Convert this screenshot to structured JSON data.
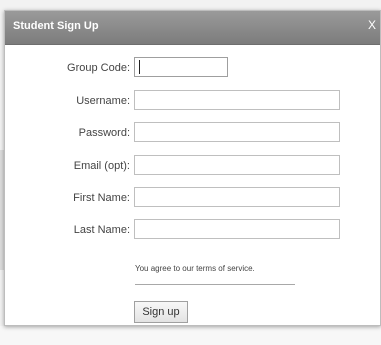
{
  "dialog": {
    "title": "Student Sign Up",
    "close_label": "X"
  },
  "form": {
    "fields": [
      {
        "label": "Group Code:",
        "value": ""
      },
      {
        "label": "Username:",
        "value": ""
      },
      {
        "label": "Password:",
        "value": ""
      },
      {
        "label": "Email (opt):",
        "value": ""
      },
      {
        "label": "First Name:",
        "value": ""
      },
      {
        "label": "Last Name:",
        "value": ""
      }
    ],
    "terms_text": "You agree to our terms of service.",
    "submit_label": "Sign up"
  }
}
